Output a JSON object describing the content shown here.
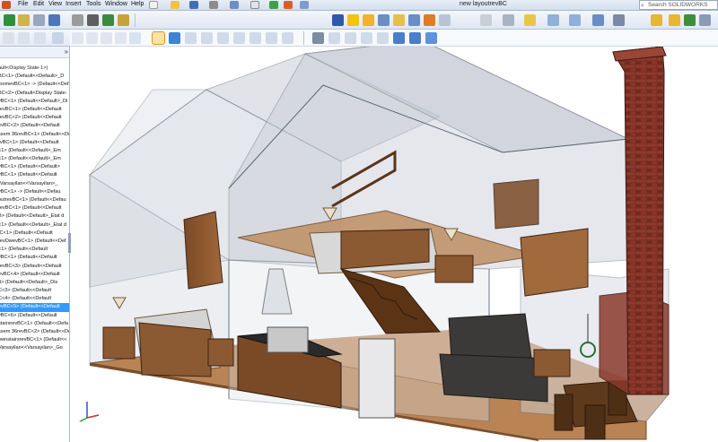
{
  "menu": [
    "File",
    "Edit",
    "View",
    "Insert",
    "Tools",
    "Window",
    "Help"
  ],
  "document_title": "new layoutrevBC",
  "search_placeholder": "Search SOLIDWORKS Help",
  "feature_tree": {
    "top_item": "ault<Display State-1>)",
    "items": [
      "BC<1> (Default<<Default>_D",
      "loomevBC<1> -> (Default<<Def",
      "BC<2> (Default<Display State-",
      "vBC<1> (Default<<Default>_Di",
      "revBC<1> (Default<<Default",
      "revBC<2> (Default<<Default",
      "evBC<2> (Default<<Default",
      "ssem 36revBC<1> (Default<<De",
      "rvBC<1> (Default<<Default",
      "<1> (Default<<Default>_Em",
      "<1> (Default<<Default>_Em",
      "vBC<1> (Default<<Default>",
      "vBC<1> (Default<<Default",
      "(Varsayilan<<Varsayilan>_",
      "vBC<1> -> (Default<<Defau",
      "outrevBC<1> (Default<<Defau",
      "revBC<1> (Default<<Default",
      "B> (Default<<Default>_Etat d",
      "<1> (Default<<Default>_Etat d",
      "IC<1> (Default<<Default",
      "revDwevBC<1> (Default<<Def",
      "<1> (Default<<Default",
      "vBC<1> (Default<<Default",
      "revBC<3> (Default<<Default",
      "evBC<4> (Default<<Default",
      "4> (Default<<Default>_Dis",
      "C<3> (Default<<Default",
      "C<4> (Default<<Default",
      "evBC<5> (Default<<Default",
      "vBC<6> (Default<<Default",
      "stairsrevBC<1> (Default<<Defa",
      "ssem 36revBC<2> (Default<<De",
      "ownstairsrevBC<1> (Default<<",
      "Varsayilan<<Varsayilan>_Go"
    ],
    "selected_index": 28
  },
  "colors": {
    "accent": "#3399ff",
    "chimney": "#7a2d22",
    "floor": "#b07a4a",
    "glass": "#c9cfd8",
    "wall_edge": "#6e7480"
  },
  "icons": [
    "new-icon",
    "open-icon",
    "save-icon",
    "print-icon",
    "undo-icon",
    "select-icon",
    "rebuild-icon",
    "options-icon",
    "zoom-fit-icon",
    "zoom-area-icon",
    "previous-view-icon",
    "section-view-icon",
    "view-orientation-icon",
    "display-style-icon",
    "hide-show-icon",
    "appearance-icon",
    "scene-icon",
    "view-settings-icon"
  ]
}
